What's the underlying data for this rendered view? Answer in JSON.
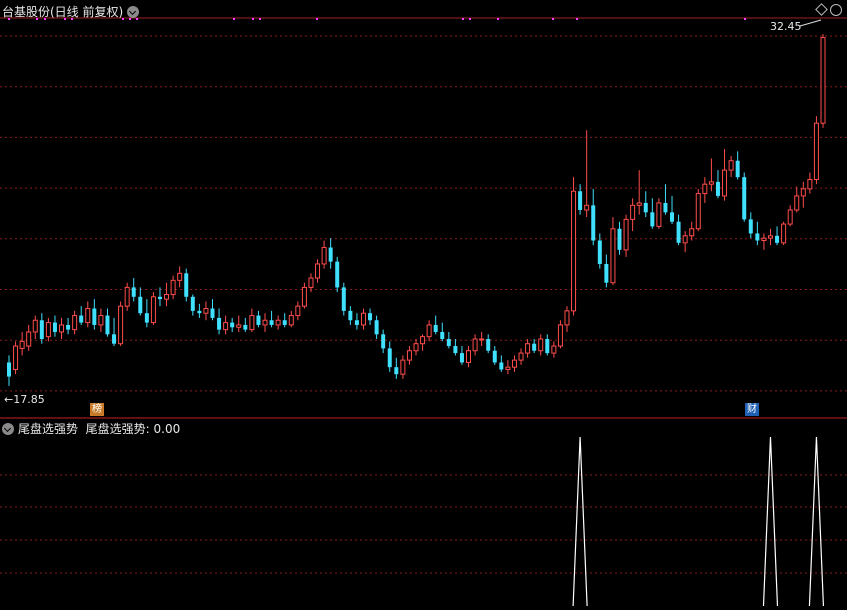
{
  "header": {
    "stock_title": "台基股份(日线 前复权)",
    "indicator_name": "尾盘选强势",
    "indicator_value_text": "尾盘选强势: 0.00"
  },
  "labels": {
    "high_price": "32.45",
    "low_price": "17.85",
    "badge_bang": "榜",
    "badge_cai": "财"
  },
  "colors": {
    "up": "#ff4d4d",
    "down": "#40e0ff",
    "grid": "#8a1c1c",
    "signal": "#ffffff",
    "marker": "#ff3cff",
    "badge_bang": "#c87a28",
    "badge_cai": "#1f5fb4"
  },
  "icons": [
    "chevron-down-icon",
    "diamond-icon",
    "circle-icon"
  ],
  "chart_data": [
    {
      "type": "candlestick",
      "title": "台基股份(日线 前复权)",
      "price_range": [
        17.85,
        32.45
      ],
      "ylim": [
        17.0,
        33.2
      ],
      "grid": true,
      "candles": [
        [
          18.6,
          18.9,
          17.6,
          18.0
        ],
        [
          18.3,
          19.5,
          18.1,
          19.3
        ],
        [
          19.2,
          19.9,
          18.9,
          19.5
        ],
        [
          19.3,
          20.2,
          19.1,
          19.9
        ],
        [
          19.9,
          20.6,
          19.6,
          20.4
        ],
        [
          20.4,
          20.7,
          19.4,
          19.6
        ],
        [
          19.7,
          20.5,
          19.5,
          20.3
        ],
        [
          20.3,
          20.6,
          19.7,
          19.9
        ],
        [
          19.9,
          20.5,
          19.6,
          20.2
        ],
        [
          20.2,
          20.5,
          19.8,
          20.0
        ],
        [
          20.0,
          20.8,
          19.8,
          20.6
        ],
        [
          20.6,
          21.0,
          20.2,
          20.3
        ],
        [
          20.3,
          21.2,
          20.1,
          20.9
        ],
        [
          20.9,
          21.3,
          20.0,
          20.2
        ],
        [
          20.2,
          20.9,
          19.9,
          20.6
        ],
        [
          20.6,
          20.9,
          19.7,
          19.8
        ],
        [
          19.8,
          20.5,
          19.3,
          19.4
        ],
        [
          19.4,
          21.2,
          19.3,
          21.0
        ],
        [
          21.0,
          22.0,
          20.8,
          21.8
        ],
        [
          21.8,
          22.2,
          21.2,
          21.4
        ],
        [
          21.4,
          21.8,
          20.6,
          20.7
        ],
        [
          20.7,
          21.3,
          20.1,
          20.3
        ],
        [
          20.3,
          21.6,
          20.2,
          21.4
        ],
        [
          21.4,
          21.8,
          21.0,
          21.3
        ],
        [
          21.3,
          22.0,
          21.0,
          21.5
        ],
        [
          21.5,
          22.3,
          21.3,
          22.1
        ],
        [
          22.1,
          22.7,
          21.8,
          22.4
        ],
        [
          22.4,
          22.6,
          21.2,
          21.4
        ],
        [
          21.4,
          21.5,
          20.6,
          20.8
        ],
        [
          20.8,
          21.1,
          20.5,
          20.7
        ],
        [
          20.7,
          21.2,
          20.4,
          20.9
        ],
        [
          20.9,
          21.3,
          20.4,
          20.5
        ],
        [
          20.5,
          20.9,
          19.8,
          20.0
        ],
        [
          20.0,
          20.6,
          19.8,
          20.3
        ],
        [
          20.3,
          20.5,
          19.9,
          20.1
        ],
        [
          20.1,
          20.6,
          19.9,
          20.2
        ],
        [
          20.2,
          20.5,
          19.9,
          20.0
        ],
        [
          20.0,
          20.9,
          19.9,
          20.6
        ],
        [
          20.6,
          20.8,
          20.1,
          20.2
        ],
        [
          20.2,
          20.7,
          19.9,
          20.4
        ],
        [
          20.4,
          20.8,
          20.1,
          20.2
        ],
        [
          20.2,
          20.6,
          20.0,
          20.4
        ],
        [
          20.4,
          20.7,
          20.1,
          20.2
        ],
        [
          20.2,
          20.8,
          20.1,
          20.6
        ],
        [
          20.6,
          21.2,
          20.4,
          21.0
        ],
        [
          21.0,
          22.0,
          20.9,
          21.8
        ],
        [
          21.8,
          22.4,
          21.6,
          22.2
        ],
        [
          22.2,
          23.0,
          22.0,
          22.8
        ],
        [
          22.8,
          23.8,
          22.6,
          23.5
        ],
        [
          23.5,
          23.9,
          22.6,
          22.9
        ],
        [
          22.9,
          23.1,
          21.6,
          21.8
        ],
        [
          21.8,
          22.0,
          20.6,
          20.8
        ],
        [
          20.8,
          21.0,
          20.2,
          20.4
        ],
        [
          20.4,
          20.7,
          20.0,
          20.2
        ],
        [
          20.2,
          20.9,
          20.0,
          20.7
        ],
        [
          20.7,
          20.9,
          20.2,
          20.4
        ],
        [
          20.4,
          20.6,
          19.6,
          19.8
        ],
        [
          19.8,
          20.0,
          19.0,
          19.2
        ],
        [
          19.2,
          19.5,
          18.2,
          18.4
        ],
        [
          18.4,
          18.8,
          17.9,
          18.1
        ],
        [
          18.1,
          18.9,
          17.9,
          18.7
        ],
        [
          18.7,
          19.3,
          18.5,
          19.1
        ],
        [
          19.1,
          19.6,
          18.9,
          19.4
        ],
        [
          19.4,
          19.8,
          19.1,
          19.7
        ],
        [
          19.7,
          20.4,
          19.5,
          20.2
        ],
        [
          20.2,
          20.6,
          19.8,
          19.9
        ],
        [
          19.9,
          20.3,
          19.5,
          19.6
        ],
        [
          19.6,
          19.9,
          19.2,
          19.3
        ],
        [
          19.3,
          19.6,
          18.9,
          19.0
        ],
        [
          19.0,
          19.3,
          18.5,
          18.6
        ],
        [
          18.6,
          19.3,
          18.4,
          19.1
        ],
        [
          19.1,
          19.8,
          18.9,
          19.6
        ],
        [
          19.6,
          19.9,
          19.3,
          19.6
        ],
        [
          19.6,
          19.8,
          19.0,
          19.1
        ],
        [
          19.1,
          19.3,
          18.5,
          18.6
        ],
        [
          18.6,
          18.9,
          18.2,
          18.3
        ],
        [
          18.3,
          18.7,
          18.1,
          18.4
        ],
        [
          18.4,
          18.9,
          18.2,
          18.7
        ],
        [
          18.7,
          19.2,
          18.5,
          19.0
        ],
        [
          19.0,
          19.6,
          18.8,
          19.4
        ],
        [
          19.4,
          19.6,
          19.0,
          19.1
        ],
        [
          19.1,
          19.8,
          18.9,
          19.6
        ],
        [
          19.6,
          19.8,
          18.9,
          19.0
        ],
        [
          19.0,
          19.5,
          18.8,
          19.3
        ],
        [
          19.3,
          20.4,
          19.2,
          20.2
        ],
        [
          20.2,
          21.0,
          19.9,
          20.8
        ],
        [
          20.8,
          26.5,
          20.6,
          25.9
        ],
        [
          25.9,
          26.2,
          24.9,
          25.1
        ],
        [
          25.1,
          28.5,
          24.8,
          25.3
        ],
        [
          25.3,
          26.0,
          23.6,
          23.8
        ],
        [
          23.8,
          24.1,
          22.6,
          22.8
        ],
        [
          22.8,
          23.2,
          21.8,
          22.0
        ],
        [
          22.0,
          24.8,
          21.9,
          24.3
        ],
        [
          24.3,
          24.6,
          23.2,
          23.4
        ],
        [
          23.4,
          24.9,
          23.1,
          24.7
        ],
        [
          24.7,
          25.6,
          24.2,
          25.3
        ],
        [
          25.3,
          26.8,
          24.9,
          25.4
        ],
        [
          25.4,
          25.9,
          24.8,
          25.0
        ],
        [
          25.0,
          25.6,
          24.3,
          24.4
        ],
        [
          24.4,
          25.6,
          24.3,
          25.4
        ],
        [
          25.4,
          26.2,
          24.9,
          25.0
        ],
        [
          25.0,
          25.7,
          24.5,
          24.6
        ],
        [
          24.6,
          24.9,
          23.6,
          23.7
        ],
        [
          23.7,
          24.2,
          23.3,
          24.0
        ],
        [
          24.0,
          24.6,
          23.8,
          24.3
        ],
        [
          24.3,
          26.0,
          24.2,
          25.8
        ],
        [
          25.8,
          26.5,
          25.4,
          26.2
        ],
        [
          26.2,
          27.3,
          25.9,
          26.3
        ],
        [
          26.3,
          26.8,
          25.6,
          25.7
        ],
        [
          25.7,
          27.7,
          25.5,
          26.8
        ],
        [
          26.8,
          27.4,
          26.5,
          27.2
        ],
        [
          27.2,
          27.6,
          26.4,
          26.5
        ],
        [
          26.5,
          26.7,
          24.6,
          24.7
        ],
        [
          24.7,
          25.0,
          23.9,
          24.1
        ],
        [
          24.1,
          24.6,
          23.6,
          23.8
        ],
        [
          23.8,
          24.1,
          23.4,
          23.9
        ],
        [
          23.9,
          24.3,
          23.6,
          24.0
        ],
        [
          24.0,
          24.4,
          23.6,
          23.7
        ],
        [
          23.7,
          24.6,
          23.6,
          24.5
        ],
        [
          24.5,
          25.3,
          24.4,
          25.1
        ],
        [
          25.1,
          26.1,
          25.0,
          25.7
        ],
        [
          25.7,
          26.3,
          25.2,
          26.0
        ],
        [
          26.0,
          26.7,
          25.8,
          26.4
        ],
        [
          26.4,
          29.1,
          26.2,
          28.8
        ],
        [
          28.8,
          32.6,
          28.6,
          32.45
        ]
      ]
    },
    {
      "type": "line",
      "title": "尾盘选强势",
      "ylim": [
        0,
        1
      ],
      "signal_index": [
        87,
        116,
        123
      ],
      "current_value": 0.0
    }
  ]
}
